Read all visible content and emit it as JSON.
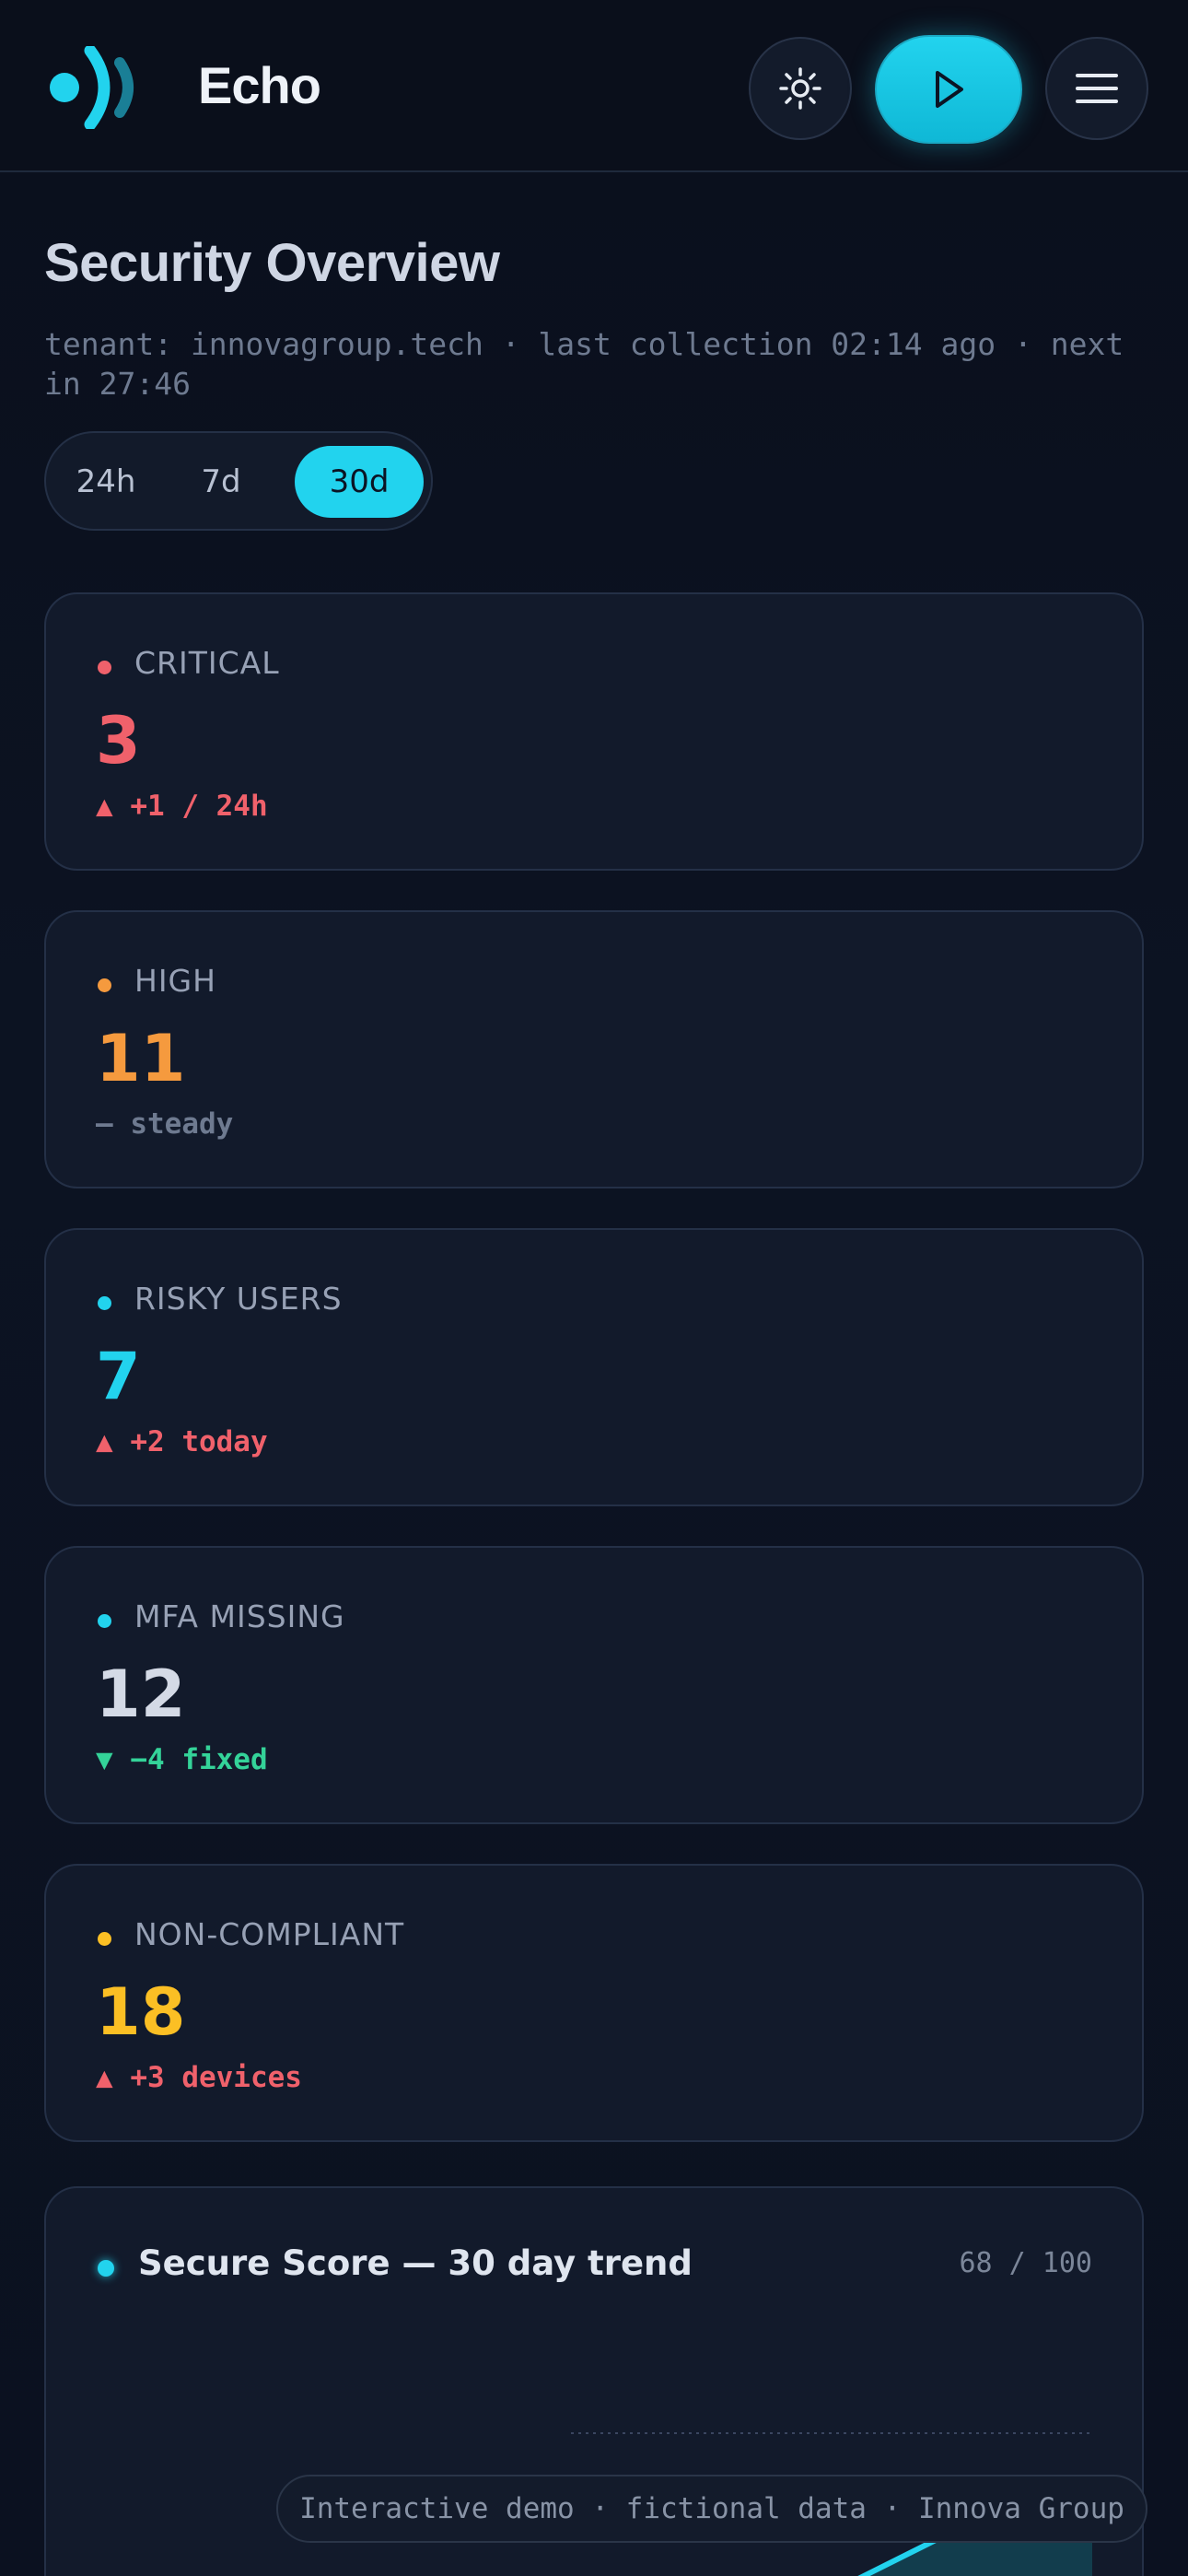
{
  "header": {
    "brand": "Echo",
    "theme_icon": "sun-icon",
    "play_icon": "play-icon",
    "menu_icon": "hamburger-menu-icon",
    "accent": "#22d3ee"
  },
  "overview": {
    "title": "Security Overview",
    "meta": "tenant: innovagroup.tech · last collection 02:14 ago · next in 27:46",
    "ranges": [
      "24h",
      "7d",
      "30d"
    ],
    "selected_range": "30d"
  },
  "cards": [
    {
      "label": "CRITICAL",
      "value": "3",
      "delta": "▲ +1 / 24h",
      "color": "#f0616b",
      "dot": "#f0616b",
      "delta_color": "#f0616b"
    },
    {
      "label": "HIGH",
      "value": "11",
      "delta": "— steady",
      "color": "#f59a3e",
      "dot": "#f59a3e",
      "delta_color": "#6e7a90"
    },
    {
      "label": "RISKY USERS",
      "value": "7",
      "delta": "▲ +2 today",
      "color": "#22d3ee",
      "dot": "#22d3ee",
      "delta_color": "#f0616b"
    },
    {
      "label": "MFA MISSING",
      "value": "12",
      "delta": "▼ −4 fixed",
      "color": "#d4dae6",
      "dot": "#22d3ee",
      "delta_color": "#34d399"
    },
    {
      "label": "NON-COMPLIANT",
      "value": "18",
      "delta": "▲ +3 devices",
      "color": "#fbbf24",
      "dot": "#fbbf24",
      "delta_color": "#f0616b"
    }
  ],
  "trend": {
    "title": "Secure Score — 30 day trend",
    "score": "68 / 100"
  },
  "footer": {
    "text": "Interactive demo · fictional data · Innova Group"
  }
}
